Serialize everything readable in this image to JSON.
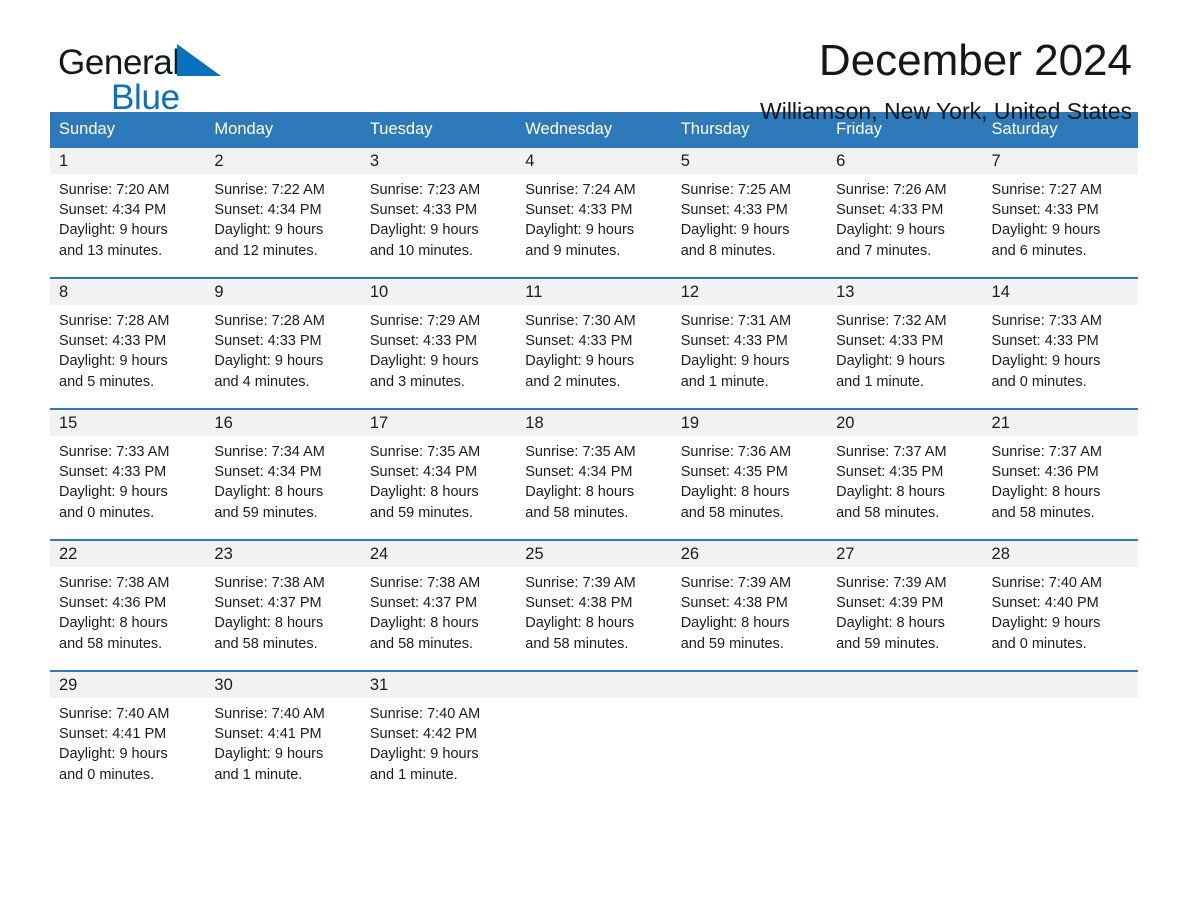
{
  "brand": {
    "name_line1": "General",
    "name_line2": "Blue",
    "triangle_icon": "triangle-icon",
    "accent_color": "#0a72bd"
  },
  "header": {
    "month_title": "December 2024",
    "location": "Williamson, New York, United States",
    "header_bg_color": "#2e79b9",
    "daynum_bg_color": "#f2f2f2"
  },
  "weekday_headers": [
    "Sunday",
    "Monday",
    "Tuesday",
    "Wednesday",
    "Thursday",
    "Friday",
    "Saturday"
  ],
  "calendar_weeks": [
    [
      {
        "day": "1",
        "sunrise": "Sunrise: 7:20 AM",
        "sunset": "Sunset: 4:34 PM",
        "daylight1": "Daylight: 9 hours",
        "daylight2": "and 13 minutes."
      },
      {
        "day": "2",
        "sunrise": "Sunrise: 7:22 AM",
        "sunset": "Sunset: 4:34 PM",
        "daylight1": "Daylight: 9 hours",
        "daylight2": "and 12 minutes."
      },
      {
        "day": "3",
        "sunrise": "Sunrise: 7:23 AM",
        "sunset": "Sunset: 4:33 PM",
        "daylight1": "Daylight: 9 hours",
        "daylight2": "and 10 minutes."
      },
      {
        "day": "4",
        "sunrise": "Sunrise: 7:24 AM",
        "sunset": "Sunset: 4:33 PM",
        "daylight1": "Daylight: 9 hours",
        "daylight2": "and 9 minutes."
      },
      {
        "day": "5",
        "sunrise": "Sunrise: 7:25 AM",
        "sunset": "Sunset: 4:33 PM",
        "daylight1": "Daylight: 9 hours",
        "daylight2": "and 8 minutes."
      },
      {
        "day": "6",
        "sunrise": "Sunrise: 7:26 AM",
        "sunset": "Sunset: 4:33 PM",
        "daylight1": "Daylight: 9 hours",
        "daylight2": "and 7 minutes."
      },
      {
        "day": "7",
        "sunrise": "Sunrise: 7:27 AM",
        "sunset": "Sunset: 4:33 PM",
        "daylight1": "Daylight: 9 hours",
        "daylight2": "and 6 minutes."
      }
    ],
    [
      {
        "day": "8",
        "sunrise": "Sunrise: 7:28 AM",
        "sunset": "Sunset: 4:33 PM",
        "daylight1": "Daylight: 9 hours",
        "daylight2": "and 5 minutes."
      },
      {
        "day": "9",
        "sunrise": "Sunrise: 7:28 AM",
        "sunset": "Sunset: 4:33 PM",
        "daylight1": "Daylight: 9 hours",
        "daylight2": "and 4 minutes."
      },
      {
        "day": "10",
        "sunrise": "Sunrise: 7:29 AM",
        "sunset": "Sunset: 4:33 PM",
        "daylight1": "Daylight: 9 hours",
        "daylight2": "and 3 minutes."
      },
      {
        "day": "11",
        "sunrise": "Sunrise: 7:30 AM",
        "sunset": "Sunset: 4:33 PM",
        "daylight1": "Daylight: 9 hours",
        "daylight2": "and 2 minutes."
      },
      {
        "day": "12",
        "sunrise": "Sunrise: 7:31 AM",
        "sunset": "Sunset: 4:33 PM",
        "daylight1": "Daylight: 9 hours",
        "daylight2": "and 1 minute."
      },
      {
        "day": "13",
        "sunrise": "Sunrise: 7:32 AM",
        "sunset": "Sunset: 4:33 PM",
        "daylight1": "Daylight: 9 hours",
        "daylight2": "and 1 minute."
      },
      {
        "day": "14",
        "sunrise": "Sunrise: 7:33 AM",
        "sunset": "Sunset: 4:33 PM",
        "daylight1": "Daylight: 9 hours",
        "daylight2": "and 0 minutes."
      }
    ],
    [
      {
        "day": "15",
        "sunrise": "Sunrise: 7:33 AM",
        "sunset": "Sunset: 4:33 PM",
        "daylight1": "Daylight: 9 hours",
        "daylight2": "and 0 minutes."
      },
      {
        "day": "16",
        "sunrise": "Sunrise: 7:34 AM",
        "sunset": "Sunset: 4:34 PM",
        "daylight1": "Daylight: 8 hours",
        "daylight2": "and 59 minutes."
      },
      {
        "day": "17",
        "sunrise": "Sunrise: 7:35 AM",
        "sunset": "Sunset: 4:34 PM",
        "daylight1": "Daylight: 8 hours",
        "daylight2": "and 59 minutes."
      },
      {
        "day": "18",
        "sunrise": "Sunrise: 7:35 AM",
        "sunset": "Sunset: 4:34 PM",
        "daylight1": "Daylight: 8 hours",
        "daylight2": "and 58 minutes."
      },
      {
        "day": "19",
        "sunrise": "Sunrise: 7:36 AM",
        "sunset": "Sunset: 4:35 PM",
        "daylight1": "Daylight: 8 hours",
        "daylight2": "and 58 minutes."
      },
      {
        "day": "20",
        "sunrise": "Sunrise: 7:37 AM",
        "sunset": "Sunset: 4:35 PM",
        "daylight1": "Daylight: 8 hours",
        "daylight2": "and 58 minutes."
      },
      {
        "day": "21",
        "sunrise": "Sunrise: 7:37 AM",
        "sunset": "Sunset: 4:36 PM",
        "daylight1": "Daylight: 8 hours",
        "daylight2": "and 58 minutes."
      }
    ],
    [
      {
        "day": "22",
        "sunrise": "Sunrise: 7:38 AM",
        "sunset": "Sunset: 4:36 PM",
        "daylight1": "Daylight: 8 hours",
        "daylight2": "and 58 minutes."
      },
      {
        "day": "23",
        "sunrise": "Sunrise: 7:38 AM",
        "sunset": "Sunset: 4:37 PM",
        "daylight1": "Daylight: 8 hours",
        "daylight2": "and 58 minutes."
      },
      {
        "day": "24",
        "sunrise": "Sunrise: 7:38 AM",
        "sunset": "Sunset: 4:37 PM",
        "daylight1": "Daylight: 8 hours",
        "daylight2": "and 58 minutes."
      },
      {
        "day": "25",
        "sunrise": "Sunrise: 7:39 AM",
        "sunset": "Sunset: 4:38 PM",
        "daylight1": "Daylight: 8 hours",
        "daylight2": "and 58 minutes."
      },
      {
        "day": "26",
        "sunrise": "Sunrise: 7:39 AM",
        "sunset": "Sunset: 4:38 PM",
        "daylight1": "Daylight: 8 hours",
        "daylight2": "and 59 minutes."
      },
      {
        "day": "27",
        "sunrise": "Sunrise: 7:39 AM",
        "sunset": "Sunset: 4:39 PM",
        "daylight1": "Daylight: 8 hours",
        "daylight2": "and 59 minutes."
      },
      {
        "day": "28",
        "sunrise": "Sunrise: 7:40 AM",
        "sunset": "Sunset: 4:40 PM",
        "daylight1": "Daylight: 9 hours",
        "daylight2": "and 0 minutes."
      }
    ],
    [
      {
        "day": "29",
        "sunrise": "Sunrise: 7:40 AM",
        "sunset": "Sunset: 4:41 PM",
        "daylight1": "Daylight: 9 hours",
        "daylight2": "and 0 minutes."
      },
      {
        "day": "30",
        "sunrise": "Sunrise: 7:40 AM",
        "sunset": "Sunset: 4:41 PM",
        "daylight1": "Daylight: 9 hours",
        "daylight2": "and 1 minute."
      },
      {
        "day": "31",
        "sunrise": "Sunrise: 7:40 AM",
        "sunset": "Sunset: 4:42 PM",
        "daylight1": "Daylight: 9 hours",
        "daylight2": "and 1 minute."
      },
      {
        "day": "",
        "sunrise": "",
        "sunset": "",
        "daylight1": "",
        "daylight2": ""
      },
      {
        "day": "",
        "sunrise": "",
        "sunset": "",
        "daylight1": "",
        "daylight2": ""
      },
      {
        "day": "",
        "sunrise": "",
        "sunset": "",
        "daylight1": "",
        "daylight2": ""
      },
      {
        "day": "",
        "sunrise": "",
        "sunset": "",
        "daylight1": "",
        "daylight2": ""
      }
    ]
  ]
}
